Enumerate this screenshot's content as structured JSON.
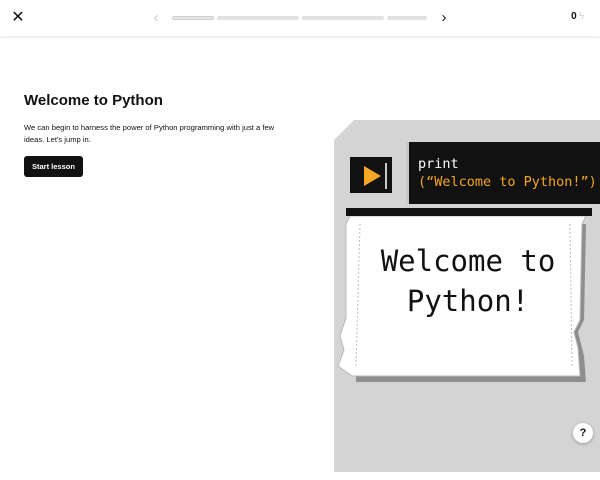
{
  "topbar": {
    "close_icon": "close-icon",
    "prev_icon": "chevron-left-icon",
    "next_icon": "chevron-right-icon",
    "progress_segments": [
      {
        "state": "current"
      },
      {
        "state": "upcoming"
      },
      {
        "state": "upcoming"
      },
      {
        "state": "upcoming"
      }
    ],
    "energy_count": "0",
    "energy_icon": "bolt-icon",
    "close_glyph": "✕",
    "prev_glyph": "‹",
    "next_glyph": "›",
    "bolt_glyph": "ϟ"
  },
  "intro": {
    "title": "Welcome to Python",
    "body": "We can begin to harness the power of Python programming with just a few ideas. Let's jump in.",
    "start_label": "Start lesson"
  },
  "illustration": {
    "code_keyword": "print",
    "code_string": "(“Welcome to Python!”)",
    "output_line1": "Welcome to",
    "output_line2": "Python!",
    "play_icon": "play-icon",
    "colors": {
      "panel_bg": "#d4d4d4",
      "accent": "#f5a623",
      "dark": "#111111"
    }
  },
  "help": {
    "label": "?"
  }
}
